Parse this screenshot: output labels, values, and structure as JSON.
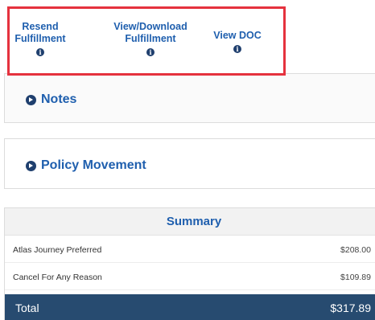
{
  "actions": {
    "resend": {
      "line1": "Resend",
      "line2": "Fulfillment",
      "icon": "info-icon",
      "icon_glyph": "i"
    },
    "view_download": {
      "line1": "View/Download",
      "line2": "Fulfillment",
      "icon": "info-icon",
      "icon_glyph": "i"
    },
    "view_doc": {
      "line1": "View DOC",
      "icon": "info-icon",
      "icon_glyph": "i"
    }
  },
  "panels": {
    "notes": {
      "title": "Notes",
      "icon": "circle-arrow-right-icon"
    },
    "policy_movement": {
      "title": "Policy Movement",
      "icon": "circle-arrow-right-icon"
    }
  },
  "summary": {
    "title": "Summary",
    "rows": [
      {
        "name": "Atlas Journey Preferred",
        "amount": "$208.00"
      },
      {
        "name": "Cancel For Any Reason",
        "amount": "$109.89"
      }
    ],
    "total": {
      "name": "Total",
      "amount": "$317.89"
    }
  },
  "colors": {
    "link": "#1f5fae",
    "highlight_border": "#e5323e",
    "total_bar": "#274b70"
  }
}
